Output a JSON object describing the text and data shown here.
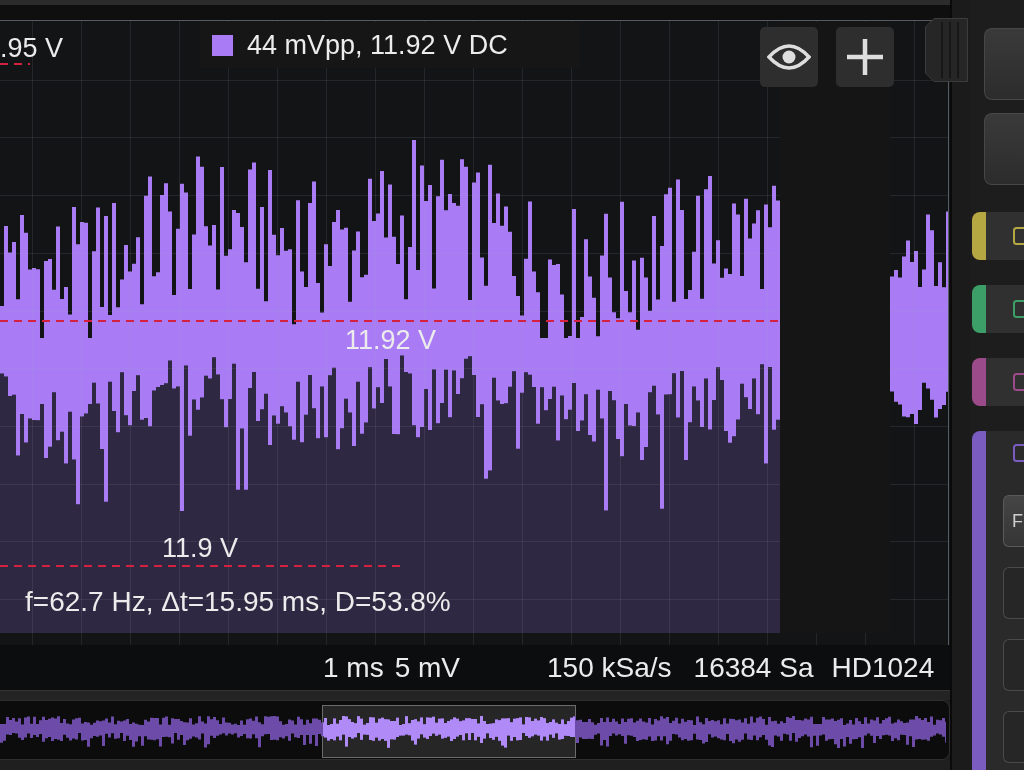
{
  "legend": {
    "text": "44 mVpp, 11.92 V DC"
  },
  "cursors": [
    {
      "label": ".95 V"
    },
    {
      "label": "11.92 V"
    },
    {
      "label": "11.9 V"
    }
  ],
  "measurement_readout": "f=62.7 Hz, Δt=15.95 ms, D=53.8%",
  "status_bar": {
    "timebase": "1 ms",
    "vertical_scale": "5 mV",
    "sample_rate": "150 kSa/s",
    "sample_count": "16384 Sa",
    "mode": "HD1024"
  },
  "sidebar": {
    "channels": [
      {
        "color": "#b5a843",
        "expanded": false
      },
      {
        "color": "#3c9f68",
        "expanded": false
      },
      {
        "color": "#9b4a8a",
        "expanded": false
      },
      {
        "color": "#7a5cc0",
        "expanded": true,
        "buttons": [
          "F"
        ]
      }
    ]
  }
}
